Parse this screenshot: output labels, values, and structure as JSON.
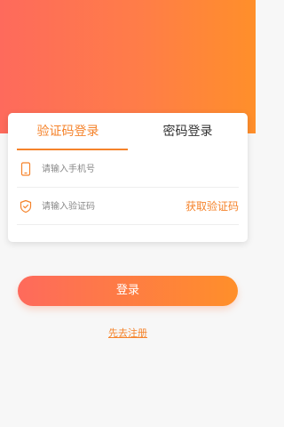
{
  "tabs": [
    {
      "label": "验证码登录",
      "active": true
    },
    {
      "label": "密码登录",
      "active": false
    }
  ],
  "phone": {
    "placeholder": "请输入手机号",
    "value": "",
    "icon": "phone-icon"
  },
  "code": {
    "placeholder": "请输入验证码",
    "value": "",
    "icon": "shield-check-icon"
  },
  "get_code_label": "获取验证码",
  "login_label": "登录",
  "register_label": "先去注册",
  "colors": {
    "accent": "#f5832b",
    "gradient_start": "#fe6a5c",
    "gradient_end": "#ff8f2a"
  }
}
